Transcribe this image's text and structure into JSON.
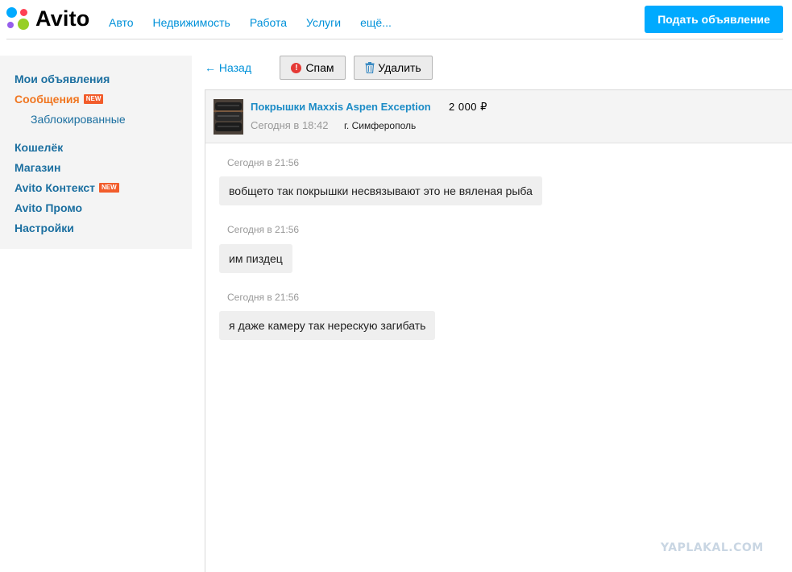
{
  "header": {
    "logo_text": "Avito",
    "nav": [
      "Авто",
      "Недвижимость",
      "Работа",
      "Услуги",
      "ещё..."
    ],
    "post_button": "Подать объявление"
  },
  "sidebar": {
    "items": [
      {
        "label": "Мои объявления"
      },
      {
        "label": "Сообщения",
        "badge": "NEW"
      },
      {
        "label": "Заблокированные"
      },
      {
        "label": "Кошелёк"
      },
      {
        "label": "Магазин"
      },
      {
        "label": "Avito Контекст",
        "badge": "NEW"
      },
      {
        "label": "Avito Промо"
      },
      {
        "label": "Настройки"
      }
    ]
  },
  "actions": {
    "back": "← Назад",
    "spam": "Спам",
    "delete": "Удалить"
  },
  "item": {
    "title": "Покрышки Maxxis Aspen Exception",
    "price": "2 000 ₽",
    "time": "Сегодня в 18:42",
    "city": "г. Симферополь"
  },
  "messages": [
    {
      "time": "Сегодня в 21:56",
      "text": "вобщето так покрышки несвязывают это не вяленая рыба"
    },
    {
      "time": "Сегодня в 21:56",
      "text": "им пиздец"
    },
    {
      "time": "Сегодня в 21:56",
      "text": "я даже камеру так нерескую загибать"
    }
  ],
  "watermark": "YAPLAKAL.COM",
  "colors": {
    "accent": "#00aaff",
    "link": "#0091d9",
    "active": "#f07620",
    "badge": "#f25c2b"
  }
}
